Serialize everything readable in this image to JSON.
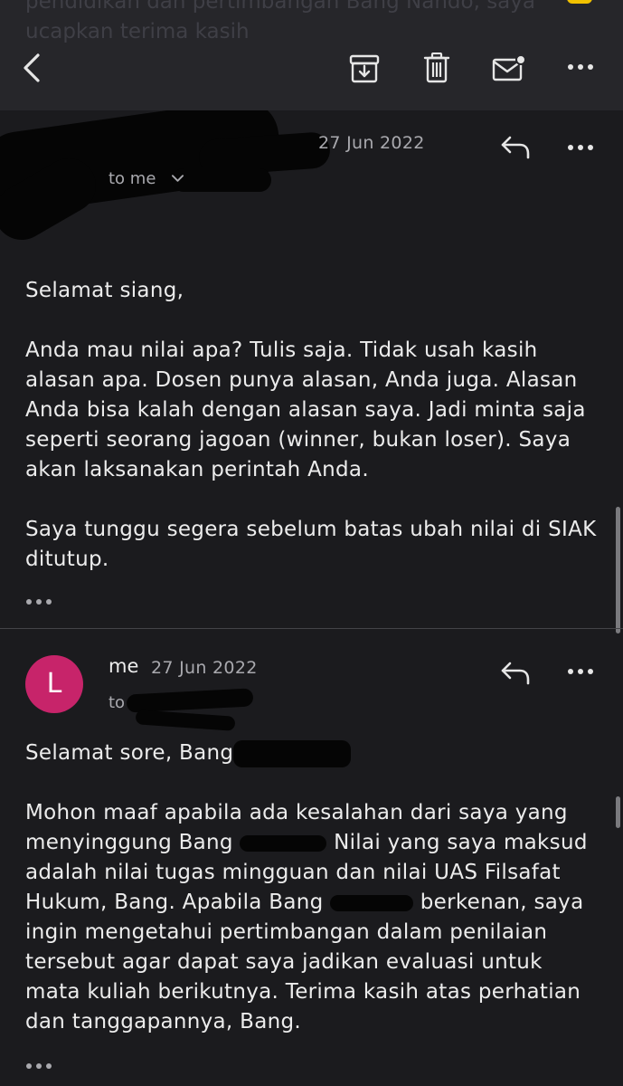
{
  "topbar": {
    "prev_message_tail": "pendidikan dan pertimbangan Bang Nando, saya ucapkan terima kasih",
    "icons": [
      "back-icon",
      "archive-icon",
      "trash-icon",
      "mark-unread-icon",
      "more-icon"
    ]
  },
  "message1": {
    "date": "27 Jun 2022",
    "to_line": "to me",
    "greeting": "Selamat siang,",
    "paragraph1": "Anda mau nilai apa? Tulis saja. Tidak usah kasih alasan apa. Dosen punya alasan, Anda juga. Alasan Anda bisa kalah dengan alasan saya. Jadi minta saja seperti seorang jagoan (winner, bukan loser). Saya akan laksanakan perintah Anda.",
    "paragraph2": "Saya tunggu segera sebelum batas ubah nilai di SIAK ditutup."
  },
  "message2": {
    "avatar_letter": "L",
    "avatar_color": "#c7246a",
    "sender": "me",
    "date": "27 Jun 2022",
    "to_line": "to",
    "greeting": "Selamat sore, Bang",
    "p2_a": "Mohon maaf apabila ada kesalahan dari saya yang menyinggung Bang",
    "p2_b": "Nilai yang saya maksud adalah nilai tugas mingguan dan nilai UAS Filsafat Hukum, Bang. Apabila Bang",
    "p2_c": "berkenan, saya ingin mengetahui pertimbangan dalam penilaian tersebut agar dapat saya jadikan evaluasi untuk mata kuliah berikutnya. Terima kasih atas perhatian dan tanggapannya, Bang."
  },
  "colors": {
    "background": "#1b1b1e",
    "toolbar": "#26262a",
    "text": "#ececec",
    "muted": "#a9a9ae"
  }
}
